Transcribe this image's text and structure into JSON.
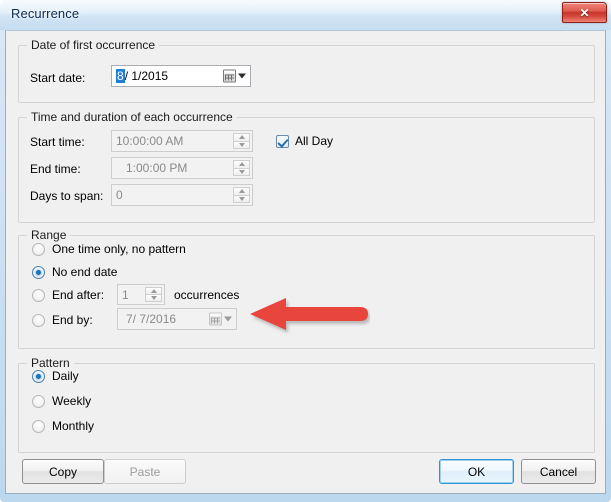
{
  "window": {
    "title": "Recurrence",
    "close_label": "✕",
    "close_icon": "close-icon"
  },
  "groups": {
    "first_occurrence": {
      "title": "Date of first occurrence",
      "start_date_label": "Start date:",
      "start_date_selected_part": "8",
      "start_date_rest": "/  1/2015",
      "start_date_value": "8/  1/2015"
    },
    "time_duration": {
      "title": "Time and duration of each occurrence",
      "start_time_label": "Start time:",
      "start_time_value": "10:00:00 AM",
      "end_time_label": "End time:",
      "end_time_value": "1:00:00 PM",
      "days_to_span_label": "Days to span:",
      "days_to_span_value": "0",
      "all_day_label": "All Day",
      "all_day_checked": true
    },
    "range": {
      "title": "Range",
      "options": [
        {
          "label": "One time only, no pattern",
          "selected": false
        },
        {
          "label": "No end date",
          "selected": true
        },
        {
          "label": "End after:",
          "selected": false
        },
        {
          "label": "End by:",
          "selected": false
        }
      ],
      "end_after_value": "1",
      "occurrences_label": "occurrences",
      "end_by_value": "7/  7/2016"
    },
    "pattern": {
      "title": "Pattern",
      "options": [
        {
          "label": "Daily",
          "selected": true
        },
        {
          "label": "Weekly",
          "selected": false
        },
        {
          "label": "Monthly",
          "selected": false
        }
      ]
    }
  },
  "buttons": {
    "copy": "Copy",
    "paste": "Paste",
    "ok": "OK",
    "cancel": "Cancel"
  },
  "annotation": {
    "arrow_color": "#e8453c",
    "arrow_direction": "left",
    "points_at": "End by: date field"
  },
  "colors": {
    "titlebar": "#cfe3f4",
    "client_bg": "#f0f0f0",
    "close_red": "#c8352b",
    "selection_blue": "#1f7fd4",
    "radio_blue": "#1c70c0",
    "arrow_red": "#e8453c"
  }
}
